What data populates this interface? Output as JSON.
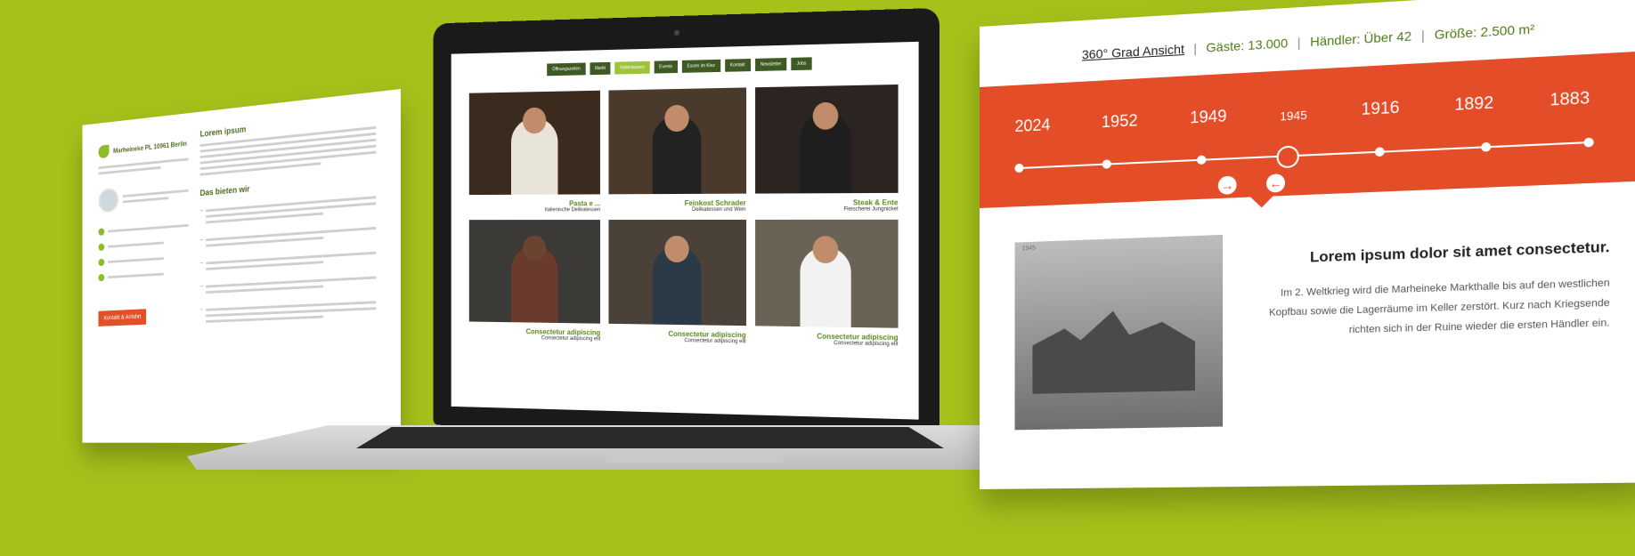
{
  "left_panel": {
    "heading_lorem": "Lorem ipsum",
    "heading_list": "Das bieten wir",
    "address_title": "Marheineke PL 10961 Berlin",
    "cta_label": "Kontakt & Anfahrt"
  },
  "laptop": {
    "nav": [
      "Öffnungszeiten",
      "Markt",
      "Hallentouren",
      "Events",
      "Essen im Kiez",
      "Kontakt",
      "Newsletter",
      "Jobs"
    ],
    "cards": [
      {
        "title": "Pasta e ...",
        "sub": "Italienische Delikatessen"
      },
      {
        "title": "Feinkost Schrader",
        "sub": "Delikatessen und Wein"
      },
      {
        "title": "Steak & Ente",
        "sub": "Fleischerei Jungnickel"
      },
      {
        "title": "Consectetur adipiscing",
        "sub": "Consectetur adipiscing elit"
      },
      {
        "title": "Consectetur adipiscing",
        "sub": "Consectetur adipiscing elit"
      },
      {
        "title": "Consectetur adipiscing",
        "sub": "Consectetur adipiscing elit"
      }
    ]
  },
  "right_panel": {
    "facts": {
      "size": "Größe: 2.500 m²",
      "traders": "Händler: Über 42",
      "guests": "Gäste: 13.000",
      "view": "360° Grad Ansicht"
    },
    "years": [
      "2024",
      "1952",
      "1949",
      "1945",
      "1916",
      "1892",
      "1883"
    ],
    "active_year": "1945",
    "photo_caption": "1945",
    "headline": "Lorem ipsum dolor sit amet consectetur.",
    "paragraph": "Im 2. Weltkrieg wird die Marheineke Markthalle bis auf den westlichen Kopfbau sowie die Lagerräume im Keller zerstört. Kurz nach Kriegsende richten sich in der Ruine wieder die ersten Händler ein."
  },
  "colors": {
    "background": "#a4c21a",
    "accent": "#e34d28",
    "brand_green": "#4c7a14"
  }
}
